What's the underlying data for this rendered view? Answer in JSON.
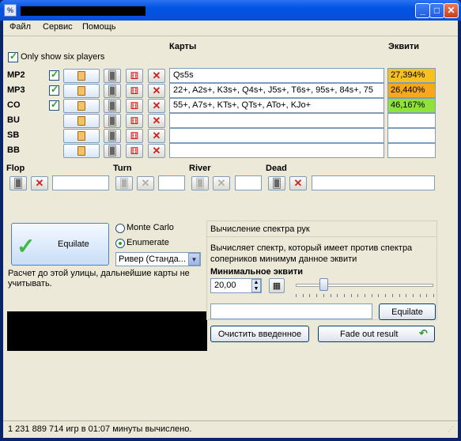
{
  "window": {
    "title_icon": "app-icon"
  },
  "menu": [
    "Файл",
    "Сервис",
    "Помощь"
  ],
  "header": {
    "cards": "Карты",
    "equity": "Эквити",
    "only_six": "Only show six players"
  },
  "players": [
    {
      "pos": "MP2",
      "range": "Qs5s",
      "equity": "27,394%",
      "color": "#f7c21d"
    },
    {
      "pos": "MP3",
      "range": "22+, A2s+, K3s+, Q4s+, J5s+, T6s+, 95s+, 84s+, 75",
      "equity": "26,440%",
      "color": "#f7a81d"
    },
    {
      "pos": "CO",
      "range": "55+, A7s+, KTs+, QTs+, ATo+, KJo+",
      "equity": "46,167%",
      "color": "#8fe23a"
    },
    {
      "pos": "BU",
      "range": "",
      "equity": ""
    },
    {
      "pos": "SB",
      "range": "",
      "equity": ""
    },
    {
      "pos": "BB",
      "range": "",
      "equity": ""
    }
  ],
  "board": {
    "flop": "Flop",
    "turn": "Turn",
    "river": "River",
    "dead": "Dead"
  },
  "equilate": {
    "label": "Equilate",
    "note": "Расчет до этой улицы, дальнейшие карты не учитывать."
  },
  "mode": {
    "monte_carlo": "Monte Carlo",
    "enumerate": "Enumerate",
    "street": "Ривер (Станда..."
  },
  "spectrum": {
    "title": "Вычисление спектра рук",
    "desc": "Вычисляет спектр, который имеет против спектра соперников минимум данное эквити",
    "min_label": "Минимальное эквити",
    "min_value": "20,00",
    "slider_fraction": 0.2,
    "equilate_btn": "Equilate"
  },
  "buttons": {
    "clear": "Очистить введенное",
    "fade": "Fade out result"
  },
  "status": "1 231 889 714 игр в 01:07 минуты вычислено."
}
